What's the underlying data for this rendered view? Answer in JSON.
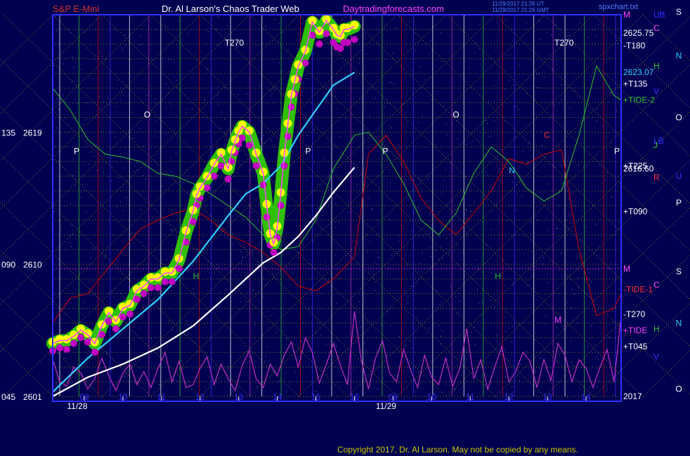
{
  "header": {
    "instrument": "S&P E-Mini",
    "site": "Dr. Al Larson's Chaos Trader Web",
    "url": "Daytradingforecasts.com",
    "stamp_line1": "11/29/2017 21:26 UT",
    "stamp_line2": "11/29/2017 21:26 GMT",
    "right_tag": "spxchart.txt"
  },
  "copyright": "Copyright 2017, Dr. Al Larson. May not be copied by any means.",
  "colors": {
    "background": "#000050",
    "frame": "#3030ff",
    "price_yellow": "#ffff00",
    "price_magenta": "#c000c0",
    "price_green": "#30c000",
    "avg_cyan": "#30d0ff",
    "avg_white": "#ffffff",
    "tide1_red": "#d00000",
    "tide2_green": "#30c030",
    "tide_magenta": "#c030c0",
    "grid_yellow": "#d8d800"
  },
  "chart_data": {
    "type": "line",
    "ylim": [
      2601,
      2627
    ],
    "xlim": [
      0,
      162
    ],
    "left_axis": [
      {
        "angle": "045",
        "price": "2601",
        "y": 2601
      },
      {
        "angle": "090",
        "price": "2610",
        "y": 2610
      },
      {
        "angle": "135",
        "price": "2619",
        "y": 2619
      }
    ],
    "x_hour_ticks": [
      {
        "label": "09",
        "x": 9
      },
      {
        "label": "10",
        "x": 20
      },
      {
        "label": "11",
        "x": 31
      },
      {
        "label": "12",
        "x": 42
      },
      {
        "label": "13",
        "x": 53
      },
      {
        "label": "14",
        "x": 64
      },
      {
        "label": "15",
        "x": 75
      },
      {
        "label": "16",
        "x": 86
      },
      {
        "label": "09",
        "x": 97
      },
      {
        "label": "10",
        "x": 108
      },
      {
        "label": "11",
        "x": 119
      },
      {
        "label": "12",
        "x": 130
      },
      {
        "label": "13",
        "x": 141
      },
      {
        "label": "14",
        "x": 152
      },
      {
        "label": "15",
        "x": 163
      }
    ],
    "x_date_ticks": [
      {
        "label": "11/28",
        "x": 7
      },
      {
        "label": "11/29",
        "x": 95
      }
    ],
    "right_labels": [
      {
        "text": "M",
        "y": 2627,
        "color": "#ff40ff"
      },
      {
        "text": "2625.75",
        "y": 2625.75,
        "color": "#ffffff"
      },
      {
        "text": "-T180",
        "y": 2624.9,
        "color": "#ffffff"
      },
      {
        "text": "2623.07",
        "y": 2623.07,
        "color": "#30d0ff"
      },
      {
        "text": "+T135",
        "y": 2622.3,
        "color": "#ffffff"
      },
      {
        "text": "+TIDE-2",
        "y": 2621.2,
        "color": "#30c030"
      },
      {
        "text": "+T225",
        "y": 2616.7,
        "color": "#ffffff"
      },
      {
        "text": "2616.60",
        "y": 2616.5,
        "color": "#ffffff"
      },
      {
        "text": "+T090",
        "y": 2613.6,
        "color": "#ffffff"
      },
      {
        "text": "M",
        "y": 2609.7,
        "color": "#ff40ff"
      },
      {
        "text": "-TIDE-1",
        "y": 2608.3,
        "color": "#ff3030"
      },
      {
        "text": "-T270",
        "y": 2606.6,
        "color": "#ffffff"
      },
      {
        "text": "+TIDE",
        "y": 2605.5,
        "color": "#ff40ff"
      },
      {
        "text": "+T045",
        "y": 2604.4,
        "color": "#ffffff"
      },
      {
        "text": "2017",
        "y": 2601,
        "color": "#ffffff"
      }
    ],
    "planet_labels": [
      {
        "text": "UB",
        "y": 2627,
        "color": "#3030ff"
      },
      {
        "text": "C",
        "y": 2626.1,
        "color": "#ff40ff"
      },
      {
        "text": "H",
        "y": 2623.5,
        "color": "#30c030"
      },
      {
        "text": "V",
        "y": 2621.8,
        "color": "#3030ff"
      },
      {
        "text": "LB",
        "y": 2618.4,
        "color": "#3030ff"
      },
      {
        "text": "J",
        "y": 2618.1,
        "color": "#30c030"
      },
      {
        "text": "R",
        "y": 2615.9,
        "color": "#ff3030"
      },
      {
        "text": "C",
        "y": 2608.6,
        "color": "#ff40ff"
      },
      {
        "text": "H",
        "y": 2605.6,
        "color": "#30c030"
      },
      {
        "text": "V",
        "y": 2603.7,
        "color": "#3030ff"
      }
    ],
    "far_right_labels": [
      {
        "text": "S",
        "y": 2627.2,
        "color": "#ffffff"
      },
      {
        "text": "N",
        "y": 2624.2,
        "color": "#30d0ff"
      },
      {
        "text": "O",
        "y": 2620.0,
        "color": "#ffffff"
      },
      {
        "text": "U",
        "y": 2616.0,
        "color": "#3030ff"
      },
      {
        "text": "P",
        "y": 2614.2,
        "color": "#ffffff"
      },
      {
        "text": "S",
        "y": 2609.5,
        "color": "#ffffff"
      },
      {
        "text": "N",
        "y": 2606.0,
        "color": "#30d0ff"
      },
      {
        "text": "O",
        "y": 2601.5,
        "color": "#ffffff"
      }
    ],
    "chart_annotations": [
      {
        "text": "T270",
        "x": 49,
        "y": 2625.1,
        "color": "#ffffff"
      },
      {
        "text": "T270",
        "x": 143,
        "y": 2625.1,
        "color": "#ffffff"
      },
      {
        "text": "O",
        "x": 26,
        "y": 2620.2,
        "color": "#ffffff"
      },
      {
        "text": "O",
        "x": 114,
        "y": 2620.2,
        "color": "#ffffff"
      },
      {
        "text": "P",
        "x": 6,
        "y": 2617.7,
        "color": "#ffffff"
      },
      {
        "text": "P",
        "x": 72,
        "y": 2617.7,
        "color": "#ffffff"
      },
      {
        "text": "P",
        "x": 94,
        "y": 2617.7,
        "color": "#ffffff"
      },
      {
        "text": "P",
        "x": 160,
        "y": 2617.7,
        "color": "#ffffff"
      },
      {
        "text": "C",
        "x": 140,
        "y": 2618.8,
        "color": "#ff3030"
      },
      {
        "text": "N",
        "x": 130,
        "y": 2616.4,
        "color": "#30d0ff"
      },
      {
        "text": "H",
        "x": 40,
        "y": 2609.2,
        "color": "#30c030"
      },
      {
        "text": "H",
        "x": 126,
        "y": 2609.2,
        "color": "#30c030"
      },
      {
        "text": "M",
        "x": 143,
        "y": 2606.2,
        "color": "#ff40ff"
      }
    ],
    "series": [
      {
        "color": "#ffff00",
        "x": [
          0,
          2,
          4,
          6,
          8,
          10,
          12,
          14,
          16,
          18,
          20,
          22,
          24,
          26,
          28,
          30,
          32,
          34,
          36,
          38,
          40,
          41,
          42,
          44,
          46,
          48,
          50,
          51,
          52,
          53,
          54,
          56,
          58,
          60,
          61,
          62,
          63,
          64,
          65,
          66,
          67,
          68,
          69,
          70,
          72,
          74,
          76,
          78,
          80,
          81,
          82,
          83,
          84,
          86
        ],
        "y": [
          2604.6,
          2604.8,
          2604.8,
          2605.1,
          2605.5,
          2605.2,
          2604.6,
          2605.8,
          2606.7,
          2606.1,
          2607.0,
          2607.2,
          2608.2,
          2608.5,
          2609.0,
          2609.0,
          2609.4,
          2609.4,
          2610.3,
          2612.2,
          2613.6,
          2614.7,
          2615.2,
          2615.9,
          2616.8,
          2617.5,
          2616.5,
          2617.7,
          2618.4,
          2619.0,
          2619.4,
          2619.0,
          2617.5,
          2616.2,
          2614.0,
          2612.0,
          2611.4,
          2612.5,
          2614.8,
          2617.5,
          2619.5,
          2621.5,
          2622.5,
          2623.5,
          2624.5,
          2626.5,
          2625.8,
          2626.6,
          2626.0,
          2625.6,
          2625.5,
          2626.0,
          2626.0,
          2626.2
        ]
      },
      {
        "color": "#c000c0",
        "x": [
          0,
          2,
          4,
          6,
          8,
          10,
          12,
          14,
          16,
          18,
          20,
          22,
          24,
          26,
          28,
          30,
          32,
          34,
          36,
          38,
          40,
          41,
          42,
          44,
          46,
          48,
          50,
          51,
          52,
          53,
          54,
          56,
          58,
          60,
          61,
          62,
          63,
          64,
          65,
          66,
          67,
          68,
          69,
          70,
          72,
          74,
          76,
          78,
          80,
          81,
          82,
          83,
          84,
          86
        ],
        "y": [
          2604.3,
          2604.5,
          2604.4,
          2604.8,
          2605.2,
          2604.9,
          2604.2,
          2605.4,
          2606.3,
          2605.8,
          2606.6,
          2606.8,
          2607.8,
          2608.2,
          2608.6,
          2608.6,
          2609.0,
          2609.0,
          2609.9,
          2611.7,
          2613.1,
          2614.2,
          2614.7,
          2615.4,
          2616.2,
          2616.9,
          2616.0,
          2617.2,
          2617.8,
          2618.4,
          2618.8,
          2618.3,
          2616.9,
          2615.6,
          2613.4,
          2611.5,
          2611.0,
          2612.0,
          2614.2,
          2616.9,
          2618.9,
          2620.9,
          2621.8,
          2622.8,
          2623.9,
          2625.8,
          2625.2,
          2625.9,
          2625.3,
          2625.0,
          2624.9,
          2625.3,
          2625.3,
          2625.5
        ]
      },
      {
        "color": "#30d0ff",
        "x": [
          0,
          10,
          20,
          30,
          40,
          50,
          55,
          60,
          65,
          70,
          75,
          80,
          86
        ],
        "y": [
          2601.3,
          2603.6,
          2605.6,
          2607.6,
          2610.2,
          2613.3,
          2614.8,
          2615.5,
          2616.7,
          2618.8,
          2620.5,
          2622.2,
          2623.07
        ]
      },
      {
        "color": "#ffffff",
        "x": [
          0,
          10,
          20,
          30,
          40,
          50,
          55,
          60,
          65,
          70,
          75,
          80,
          86
        ],
        "y": [
          2601.0,
          2602.3,
          2603.2,
          2604.3,
          2605.8,
          2607.9,
          2609.0,
          2610.1,
          2610.8,
          2611.9,
          2613.3,
          2614.9,
          2616.6
        ]
      },
      {
        "color": "#d00000",
        "x": [
          0,
          5,
          10,
          15,
          20,
          25,
          30,
          35,
          40,
          45,
          50,
          55,
          60,
          65,
          70,
          75,
          80,
          86,
          90,
          95,
          100,
          105,
          110,
          115,
          120,
          125,
          130,
          135,
          140,
          145,
          150,
          155,
          160,
          162
        ],
        "y": [
          2606.0,
          2607.7,
          2608.0,
          2609.5,
          2611.0,
          2612.4,
          2613.0,
          2613.5,
          2613.8,
          2613.0,
          2612.0,
          2611.5,
          2610.8,
          2609.8,
          2608.5,
          2608.2,
          2609.0,
          2610.5,
          2617.5,
          2618.8,
          2617.0,
          2614.5,
          2613.0,
          2612.0,
          2613.5,
          2615.0,
          2617.2,
          2616.8,
          2617.5,
          2617.8,
          2611.0,
          2606.5,
          2607.0,
          2608.0
        ]
      },
      {
        "color": "#30c030",
        "x": [
          0,
          5,
          10,
          15,
          20,
          25,
          30,
          35,
          40,
          45,
          50,
          55,
          60,
          65,
          70,
          75,
          80,
          86,
          90,
          95,
          100,
          105,
          110,
          115,
          120,
          125,
          130,
          135,
          140,
          145,
          150,
          155,
          160,
          162
        ],
        "y": [
          2622.0,
          2620.5,
          2618.5,
          2617.5,
          2617.3,
          2617.0,
          2616.2,
          2616.0,
          2615.5,
          2614.8,
          2614.0,
          2613.2,
          2612.0,
          2611.0,
          2611.2,
          2613.0,
          2616.5,
          2618.8,
          2619.0,
          2617.5,
          2615.5,
          2613.0,
          2612.0,
          2613.5,
          2616.2,
          2618.0,
          2617.0,
          2615.2,
          2614.3,
          2615.0,
          2618.8,
          2623.5,
          2621.5,
          2621.2
        ]
      },
      {
        "color": "#c030c0",
        "x": [
          0,
          2,
          4,
          6,
          8,
          10,
          12,
          14,
          16,
          18,
          20,
          22,
          24,
          26,
          28,
          30,
          32,
          34,
          36,
          38,
          40,
          42,
          44,
          46,
          48,
          50,
          52,
          54,
          56,
          58,
          60,
          62,
          64,
          66,
          68,
          70,
          72,
          74,
          76,
          78,
          80,
          82,
          84,
          86,
          88,
          90,
          92,
          94,
          96,
          98,
          100,
          102,
          104,
          106,
          108,
          110,
          112,
          114,
          116,
          118,
          120,
          122,
          124,
          126,
          128,
          130,
          132,
          134,
          136,
          138,
          140,
          142,
          144,
          146,
          148,
          150,
          152,
          154,
          156,
          158,
          160,
          162
        ],
        "y": [
          2603.5,
          2602.0,
          2601.7,
          2603.0,
          2602.6,
          2601.5,
          2602.2,
          2603.6,
          2602.4,
          2601.4,
          2602.6,
          2603.2,
          2601.8,
          2602.7,
          2601.6,
          2602.9,
          2604.0,
          2602.0,
          2603.4,
          2601.6,
          2601.8,
          2602.9,
          2603.7,
          2601.8,
          2603.2,
          2602.2,
          2601.4,
          2603.1,
          2604.1,
          2602.2,
          2601.6,
          2603.2,
          2602.4,
          2603.8,
          2604.7,
          2603.0,
          2605.0,
          2604.0,
          2601.9,
          2603.2,
          2604.6,
          2603.1,
          2601.8,
          2606.8,
          2603.4,
          2601.5,
          2603.6,
          2604.8,
          2602.6,
          2602.0,
          2604.2,
          2602.8,
          2601.6,
          2603.8,
          2602.3,
          2601.8,
          2603.6,
          2601.7,
          2602.9,
          2605.6,
          2602.2,
          2603.5,
          2601.5,
          2603.0,
          2604.4,
          2602.0,
          2602.7,
          2604.0,
          2603.4,
          2601.6,
          2603.5,
          2602.1,
          2604.6,
          2603.8,
          2602.0,
          2603.5,
          2602.9,
          2601.6,
          2603.0,
          2604.2,
          2602.0,
          2606.5
        ]
      }
    ]
  }
}
